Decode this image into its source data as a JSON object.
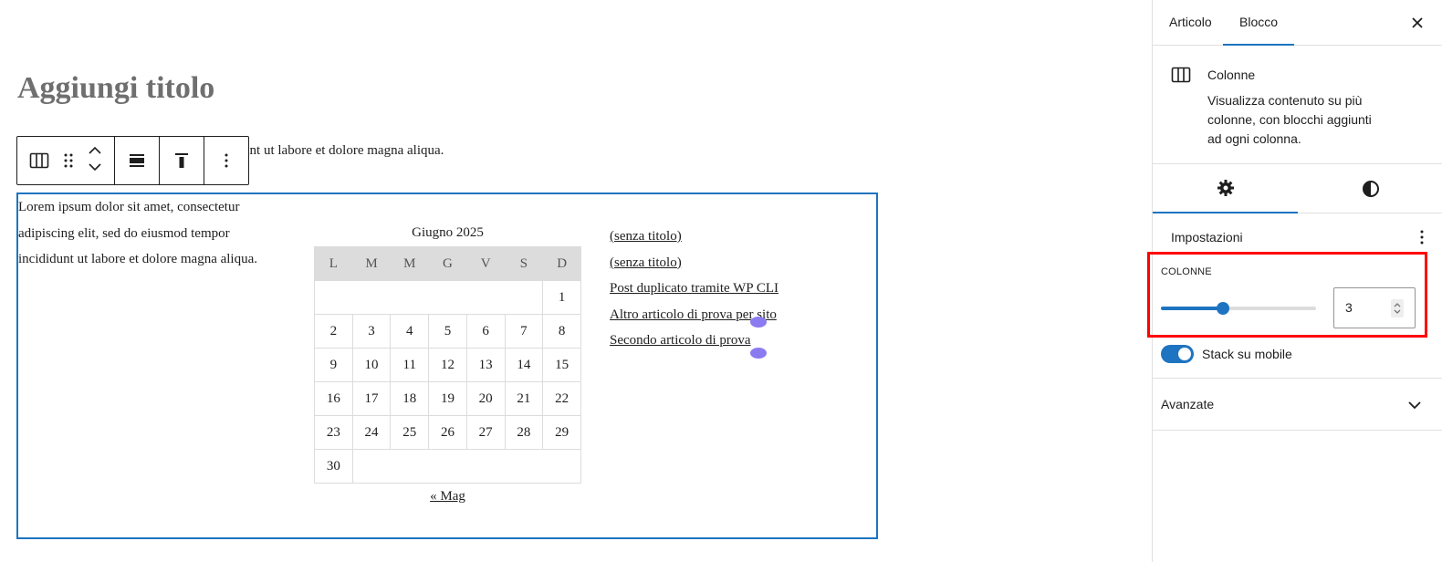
{
  "editor": {
    "title_placeholder": "Aggiungi titolo",
    "paragraph_behind_toolbar": "scing elit, sed do eiusmod tempor incididunt ut labore et dolore magna aliqua.",
    "column1_text": "Lorem ipsum dolor sit amet, consectetur adipiscing elit, sed do eiusmod tempor incididunt ut labore et dolore magna aliqua.",
    "toolbar": {
      "icons": [
        "columns-block-icon",
        "drag-handle-icon",
        "move-up-icon",
        "move-down-icon",
        "align-icon",
        "vertical-align-top-icon",
        "more-options-icon"
      ]
    },
    "calendar": {
      "caption": "Giugno 2025",
      "weekdays": [
        "L",
        "M",
        "M",
        "G",
        "V",
        "S",
        "D"
      ],
      "weeks": [
        [
          "",
          "",
          "",
          "",
          "",
          "",
          "1"
        ],
        [
          "2",
          "3",
          "4",
          "5",
          "6",
          "7",
          "8"
        ],
        [
          "9",
          "10",
          "11",
          "12",
          "13",
          "14",
          "15"
        ],
        [
          "16",
          "17",
          "18",
          "19",
          "20",
          "21",
          "22"
        ],
        [
          "23",
          "24",
          "25",
          "26",
          "27",
          "28",
          "29"
        ],
        [
          "30",
          "",
          "",
          "",
          "",
          "",
          ""
        ]
      ],
      "prev_link": "« Mag"
    },
    "recent_posts": [
      "(senza titolo)",
      "(senza titolo)",
      "Post duplicato tramite WP CLI",
      "Altro articolo di prova per sito",
      "Secondo articolo di prova"
    ]
  },
  "sidebar": {
    "tabs": [
      "Articolo",
      "Blocco"
    ],
    "active_tab": "Blocco",
    "block": {
      "name": "Colonne",
      "description": "Visualizza contenuto su più colonne, con blocchi aggiunti ad ogni colonna."
    },
    "subtabs": [
      "settings-icon",
      "styles-icon"
    ],
    "settings_panel": {
      "title": "Impostazioni",
      "columns_label": "COLONNE",
      "columns_value": "3",
      "slider_fraction": 0.4,
      "stack_label": "Stack su mobile",
      "stack_on": true
    },
    "advanced_label": "Avanzate"
  },
  "colors": {
    "accent": "#1e74c0",
    "highlight": "#ff0000",
    "marker": "#8a7bf0"
  }
}
